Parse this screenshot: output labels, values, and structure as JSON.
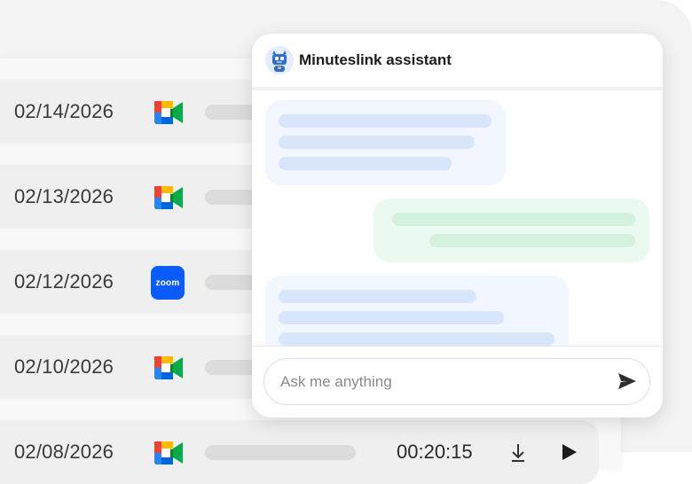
{
  "meetings": [
    {
      "date": "02/14/2026",
      "platform": "google-meet-icon"
    },
    {
      "date": "02/13/2026",
      "platform": "google-meet-icon"
    },
    {
      "date": "02/12/2026",
      "platform": "zoom-icon",
      "platform_label": "zoom"
    },
    {
      "date": "02/10/2026",
      "platform": "google-meet-icon"
    },
    {
      "date": "02/08/2026",
      "platform": "google-meet-icon",
      "duration": "00:20:15",
      "actions": [
        "download-icon",
        "play-icon"
      ]
    }
  ],
  "assistant": {
    "title": "Minuteslink assistant",
    "avatar_icon": "robot-avatar-icon",
    "input_placeholder": "Ask me anything",
    "send_icon": "send-icon"
  },
  "colors": {
    "zoom_blue": "#0b5cff",
    "incoming_bubble": "#f1f6ff",
    "outgoing_bubble": "#eafaf0"
  }
}
